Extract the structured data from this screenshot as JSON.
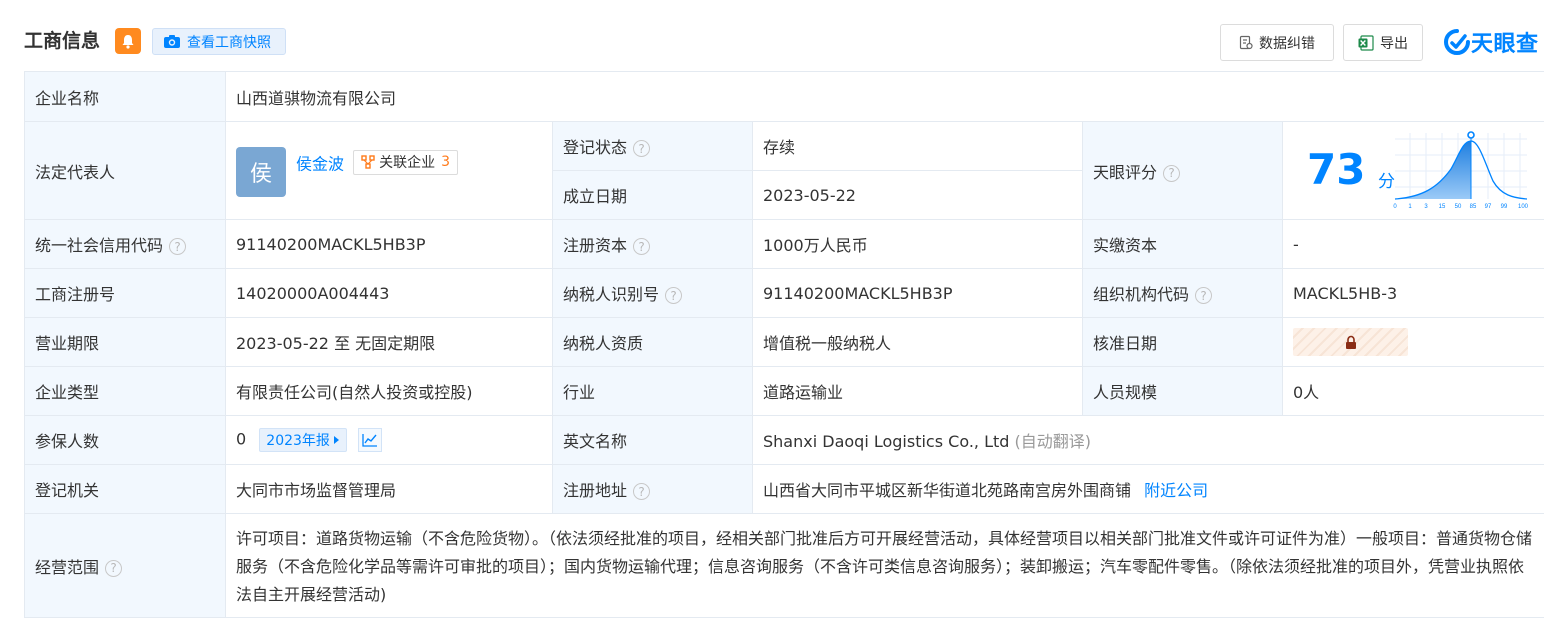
{
  "header": {
    "title": "工商信息",
    "snapshot_button": "查看工商快照",
    "fix_button": "数据纠错",
    "export_button": "导出",
    "logo_text": "天眼查"
  },
  "company": {
    "name_label": "企业名称",
    "name": "山西道骐物流有限公司"
  },
  "legal": {
    "label": "法定代表人",
    "avatar_char": "侯",
    "name": "侯金波",
    "related_label": "关联企业",
    "related_count": "3"
  },
  "status": {
    "label": "登记状态",
    "value": "存续"
  },
  "established": {
    "label": "成立日期",
    "value": "2023-05-22"
  },
  "score": {
    "label": "天眼评分",
    "value": "73",
    "unit": "分",
    "axis_ticks": [
      "0",
      "1",
      "3",
      "15",
      "50",
      "85",
      "97",
      "99",
      "100"
    ]
  },
  "credit_code": {
    "label": "统一社会信用代码",
    "value": "91140200MACKL5HB3P"
  },
  "registered_capital": {
    "label": "注册资本",
    "value": "1000万人民币"
  },
  "paid_capital": {
    "label": "实缴资本",
    "value": "-"
  },
  "reg_no": {
    "label": "工商注册号",
    "value": "14020000A004443"
  },
  "tax_id": {
    "label": "纳税人识别号",
    "value": "91140200MACKL5HB3P"
  },
  "org_code": {
    "label": "组织机构代码",
    "value": "MACKL5HB-3"
  },
  "term": {
    "label": "营业期限",
    "value": "2023-05-22 至 无固定期限"
  },
  "taxpayer_type": {
    "label": "纳税人资质",
    "value": "增值税一般纳税人"
  },
  "approval_date": {
    "label": "核准日期"
  },
  "company_type": {
    "label": "企业类型",
    "value": "有限责任公司(自然人投资或控股)"
  },
  "industry": {
    "label": "行业",
    "value": "道路运输业"
  },
  "staff_size": {
    "label": "人员规模",
    "value": "0人"
  },
  "insured": {
    "label": "参保人数",
    "value": "0",
    "report": "2023年报"
  },
  "english_name": {
    "label": "英文名称",
    "value": "Shanxi Daoqi Logistics Co., Ltd",
    "note": "(自动翻译)"
  },
  "authority": {
    "label": "登记机关",
    "value": "大同市市场监督管理局"
  },
  "address": {
    "label": "注册地址",
    "value": "山西省大同市平城区新华街道北苑路南宫房外围商铺",
    "nearby": "附近公司"
  },
  "scope": {
    "label": "经营范围",
    "value": "许可项目：道路货物运输（不含危险货物）。（依法须经批准的项目，经相关部门批准后方可开展经营活动，具体经营项目以相关部门批准文件或许可证件为准）一般项目：普通货物仓储服务（不含危险化学品等需许可审批的项目）；国内货物运输代理；信息咨询服务（不含许可类信息咨询服务）；装卸搬运；汽车零配件零售。（除依法须经批准的项目外，凭营业执照依法自主开展经营活动)"
  },
  "colors": {
    "accent": "#0084ff",
    "label_bg": "#f2f8fe",
    "status_green": "#1ea84d",
    "bell_orange": "#ff8a1f"
  }
}
